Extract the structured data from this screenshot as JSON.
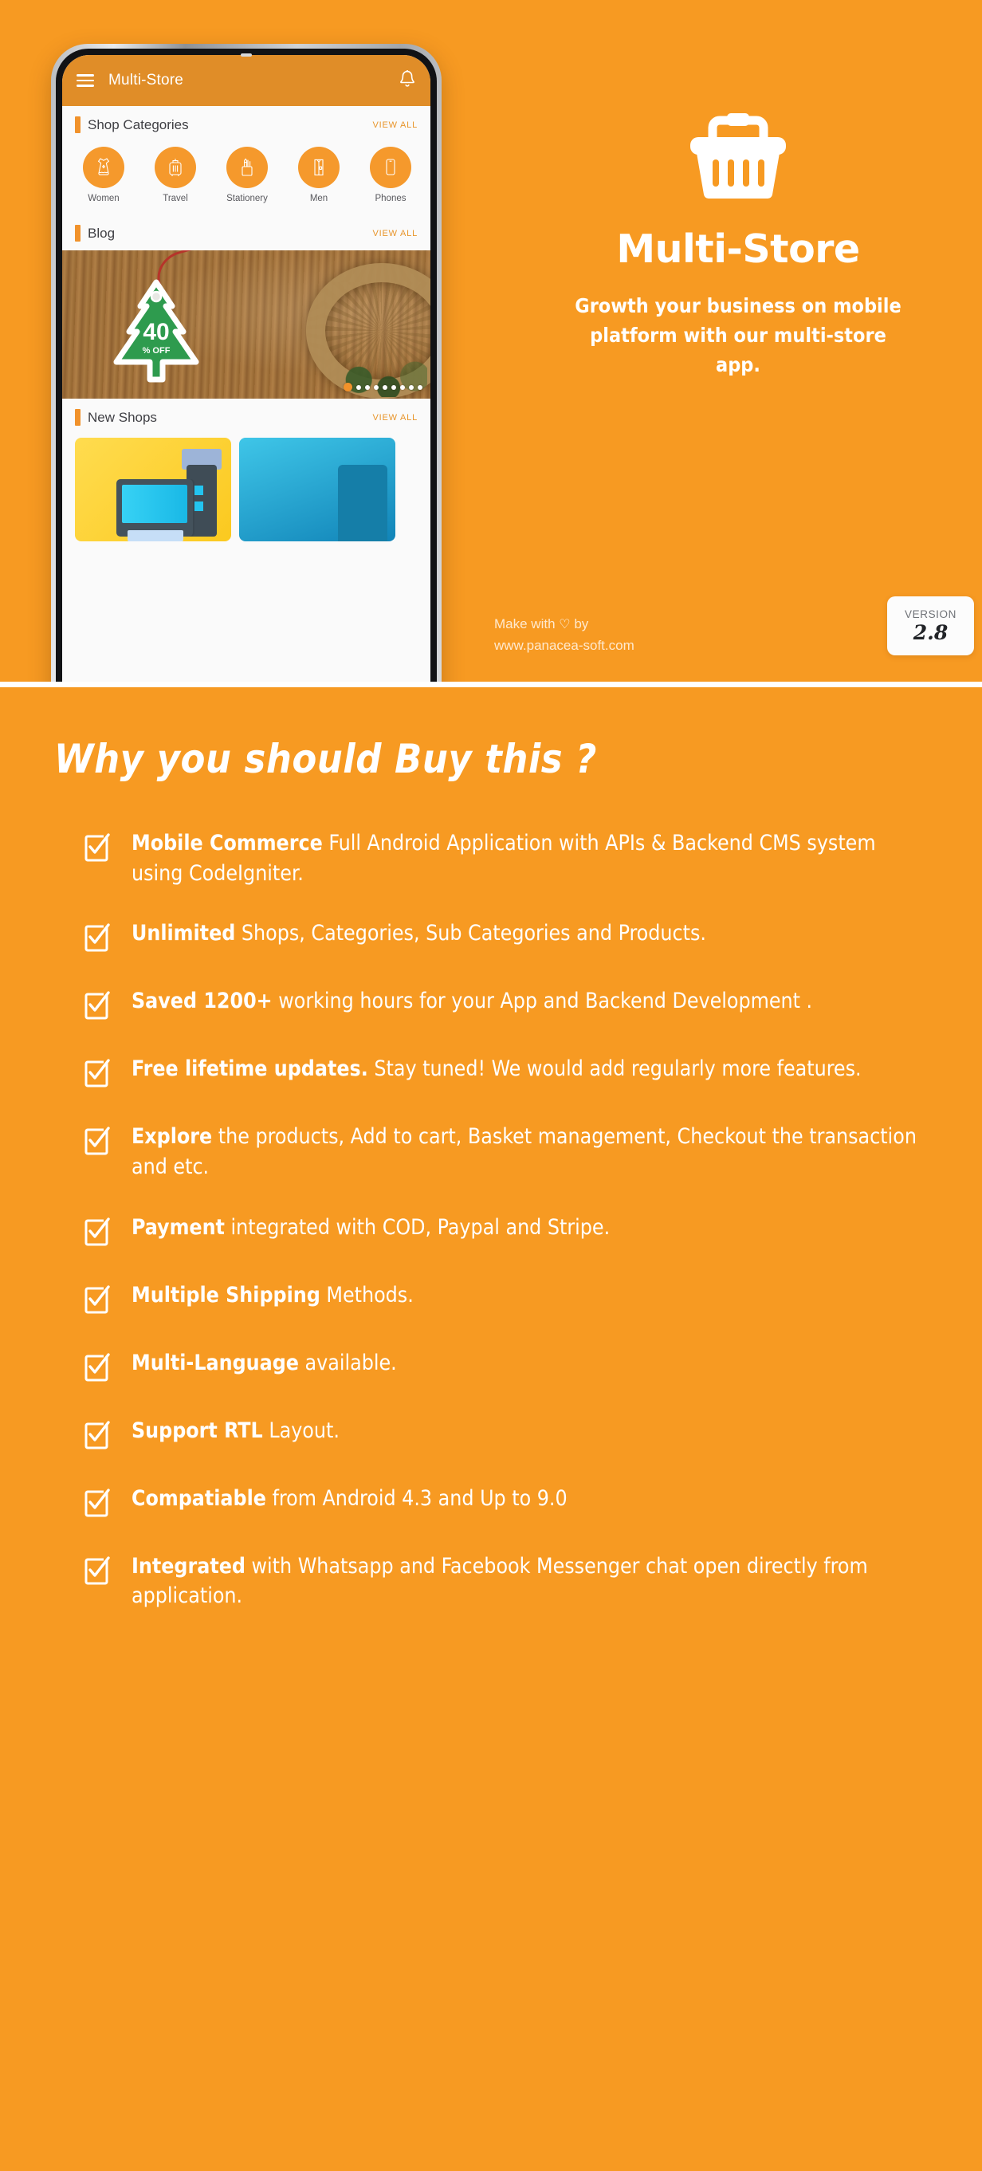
{
  "theme": {
    "background": "#F79A22",
    "accent": "#F1922B",
    "appbar": "#E08D28",
    "text_on_orange": "#FFFFFF"
  },
  "hero": {
    "brand_title": "Multi-Store",
    "brand_tagline": "Growth your business on mobile platform with our multi-store app.",
    "basket_icon": "shopping-basket-icon",
    "credit_line1_prefix": "Make with",
    "credit_heart": "♡",
    "credit_line1_suffix": "by",
    "credit_website": "www.panacea-soft.com",
    "version_label": "VERSION",
    "version_number": "2.8"
  },
  "phone": {
    "app_bar": {
      "menu_icon": "hamburger-menu-icon",
      "title": "Multi-Store",
      "notification_icon": "bell-icon"
    },
    "sections": [
      {
        "title": "Shop Categories",
        "view_all": "VIEW ALL"
      },
      {
        "title": "Blog",
        "view_all": "VIEW ALL"
      },
      {
        "title": "New Shops",
        "view_all": "VIEW ALL"
      }
    ],
    "categories": [
      {
        "label": "Women",
        "icon": "dress-icon"
      },
      {
        "label": "Travel",
        "icon": "suitcase-icon"
      },
      {
        "label": "Stationery",
        "icon": "pen-holder-icon"
      },
      {
        "label": "Men",
        "icon": "shirt-icon"
      },
      {
        "label": "Phones",
        "icon": "smartphone-icon"
      }
    ],
    "blog_banner": {
      "discount_value": "40",
      "discount_unit": "% OFF",
      "carousel_dots_total": 9,
      "carousel_active_index": 0
    }
  },
  "features": {
    "heading": "Why you should Buy this ?",
    "check_icon": "checkbox-checked-icon",
    "items": [
      {
        "bold": "Mobile Commerce",
        "rest": " Full Android Application with APIs & Backend CMS system using CodeIgniter."
      },
      {
        "bold": "Unlimited",
        "rest": " Shops, Categories, Sub Categories and Products."
      },
      {
        "bold": "Saved 1200+",
        "rest": " working hours for your App and Backend Development ."
      },
      {
        "bold": "Free lifetime updates.",
        "rest": " Stay tuned! We would add regularly more features."
      },
      {
        "bold": "Explore",
        "rest": " the products, Add to cart, Basket management, Checkout the transaction and etc."
      },
      {
        "bold": "Payment",
        "rest": " integrated with COD, Paypal and Stripe."
      },
      {
        "bold": "Multiple Shipping",
        "rest": " Methods."
      },
      {
        "bold": "Multi-Language",
        "rest": " available."
      },
      {
        "bold": "Support RTL",
        "rest": " Layout."
      },
      {
        "bold": "Compatiable",
        "rest": " from Android 4.3 and Up to 9.0"
      },
      {
        "bold": "Integrated",
        "rest": " with Whatsapp and Facebook Messenger chat open directly from application."
      }
    ]
  }
}
